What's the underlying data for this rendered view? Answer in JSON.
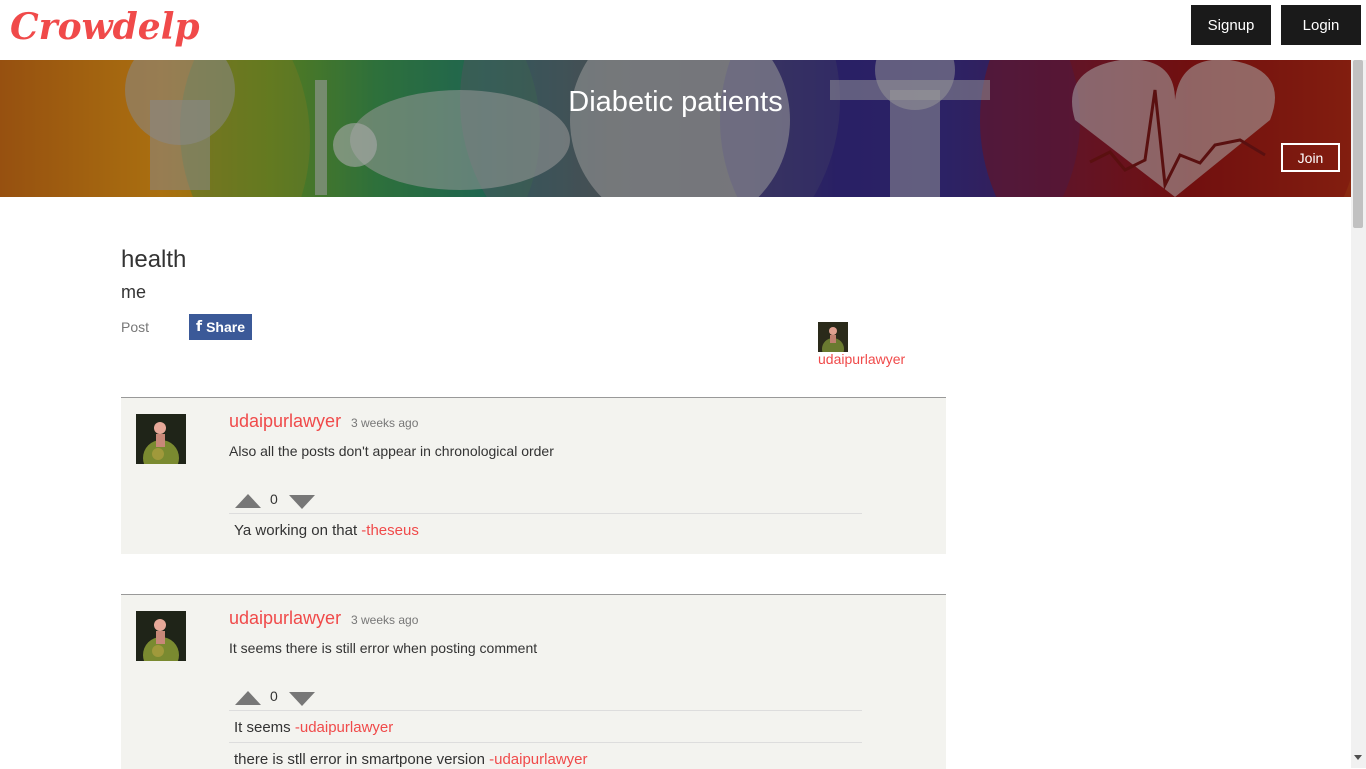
{
  "nav": {
    "logo": "Crowdelp",
    "signup": "Signup",
    "login": "Login"
  },
  "banner": {
    "title": "Diabetic patients",
    "join": "Join"
  },
  "post": {
    "title": "health",
    "subtitle": "me",
    "label": "Post",
    "share": "Share",
    "author": "udaipurlawyer"
  },
  "comments": [
    {
      "user": "udaipurlawyer",
      "time": "3 weeks ago",
      "text": "Also all the posts don't appear in chronological order",
      "votes": "0",
      "replies": [
        {
          "text": "Ya working on that ",
          "by": "-theseus"
        }
      ]
    },
    {
      "user": "udaipurlawyer",
      "time": "3 weeks ago",
      "text": "It seems there is still error when posting comment",
      "votes": "0",
      "replies": [
        {
          "text": "It seems ",
          "by": "-udaipurlawyer"
        },
        {
          "text": "there is stll error in smartpone version ",
          "by": "-udaipurlawyer"
        }
      ]
    }
  ],
  "colors": {
    "accent": "#f04a4a",
    "facebook": "#3b5998",
    "nav_button": "#1a1a1a",
    "card": "#f3f3ef"
  }
}
